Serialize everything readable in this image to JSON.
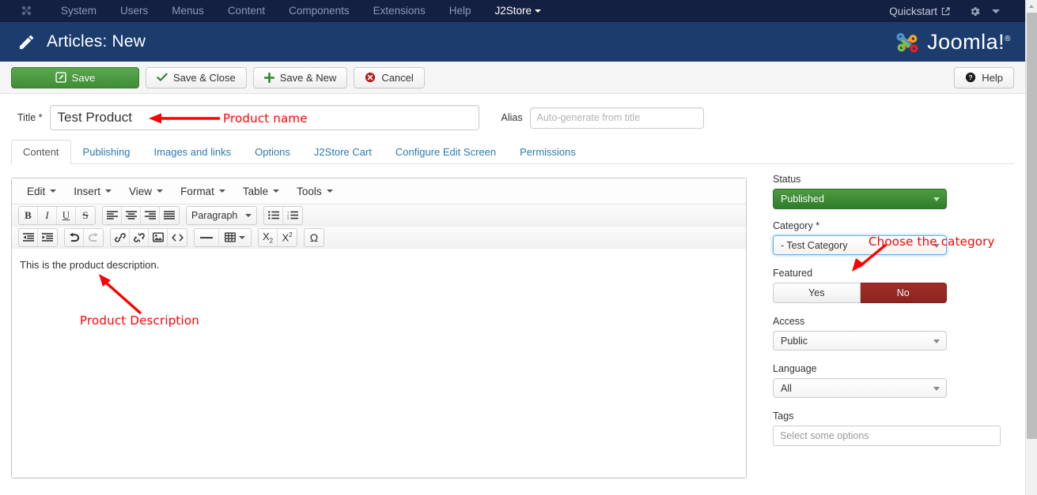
{
  "topbar": {
    "brand_icon": "joomla-logo-icon",
    "menu": [
      {
        "label": "System",
        "id": "system"
      },
      {
        "label": "Users",
        "id": "users"
      },
      {
        "label": "Menus",
        "id": "menus"
      },
      {
        "label": "Content",
        "id": "content"
      },
      {
        "label": "Components",
        "id": "components"
      },
      {
        "label": "Extensions",
        "id": "extensions"
      },
      {
        "label": "Help",
        "id": "help"
      }
    ],
    "j2store_label": "J2Store",
    "quickstart_label": "Quickstart",
    "quickstart_icon": "external-link-icon",
    "gear_icon": "gear-icon",
    "caret_icon": "chevron-down-icon",
    "bg_color": "#142042"
  },
  "subhead": {
    "icon": "pencil-icon",
    "title": "Articles: New",
    "logo_text": "Joomla!",
    "logo_sup": "®",
    "bg_color": "#1c3c6e"
  },
  "toolbar": {
    "save_label": "Save",
    "save_icon": "edit-square-icon",
    "save_close_label": "Save & Close",
    "save_close_icon": "check-icon",
    "save_new_label": "Save & New",
    "save_new_icon": "plus-icon",
    "cancel_label": "Cancel",
    "cancel_icon": "cancel-circle-icon",
    "help_label": "Help",
    "help_icon": "question-circle-icon",
    "save_color": "#3f8e35"
  },
  "title_row": {
    "title_label": "Title *",
    "title_value": "Test Product",
    "alias_label": "Alias",
    "alias_value": "",
    "alias_placeholder": "Auto-generate from title"
  },
  "tabs": [
    {
      "label": "Content",
      "active": true
    },
    {
      "label": "Publishing",
      "active": false
    },
    {
      "label": "Images and links",
      "active": false
    },
    {
      "label": "Options",
      "active": false
    },
    {
      "label": "J2Store Cart",
      "active": false
    },
    {
      "label": "Configure Edit Screen",
      "active": false
    },
    {
      "label": "Permissions",
      "active": false
    }
  ],
  "editor": {
    "menus": [
      {
        "label": "Edit"
      },
      {
        "label": "Insert"
      },
      {
        "label": "View"
      },
      {
        "label": "Format"
      },
      {
        "label": "Table"
      },
      {
        "label": "Tools"
      }
    ],
    "toolbar_row1": [
      {
        "icon": "bold-icon",
        "glyph": "B"
      },
      {
        "icon": "italic-icon",
        "glyph": "I"
      },
      {
        "icon": "underline-icon",
        "glyph": "U"
      },
      {
        "icon": "strikethrough-icon",
        "glyph": "S"
      }
    ],
    "align_buttons": [
      {
        "icon": "align-left-icon"
      },
      {
        "icon": "align-center-icon"
      },
      {
        "icon": "align-right-icon"
      },
      {
        "icon": "align-justify-icon"
      }
    ],
    "format_select": "Paragraph",
    "list_buttons": [
      {
        "icon": "bullet-list-icon"
      },
      {
        "icon": "numbered-list-icon"
      }
    ],
    "toolbar_row2_indent": [
      {
        "icon": "outdent-icon"
      },
      {
        "icon": "indent-icon"
      }
    ],
    "toolbar_row2_history": [
      {
        "icon": "undo-icon"
      },
      {
        "icon": "redo-icon"
      }
    ],
    "toolbar_row2_insert": [
      {
        "icon": "link-icon"
      },
      {
        "icon": "unlink-icon"
      },
      {
        "icon": "image-icon"
      },
      {
        "icon": "source-code-icon"
      }
    ],
    "toolbar_row2_block": [
      {
        "icon": "horizontal-rule-icon"
      },
      {
        "icon": "table-icon"
      }
    ],
    "toolbar_row2_script": [
      {
        "icon": "subscript-icon"
      },
      {
        "icon": "superscript-icon"
      }
    ],
    "toolbar_row2_special": [
      {
        "icon": "special-character-icon",
        "glyph": "Ω"
      }
    ],
    "body_text": "This is the product description."
  },
  "sidebar": {
    "status_label": "Status",
    "status_value": "Published",
    "category_label": "Category *",
    "category_value": "- Test Category",
    "featured_label": "Featured",
    "featured_yes": "Yes",
    "featured_no": "No",
    "featured_selected": "No",
    "access_label": "Access",
    "access_value": "Public",
    "language_label": "Language",
    "language_value": "All",
    "tags_label": "Tags",
    "tags_placeholder": "Select some options",
    "published_color": "#3f8e35",
    "no_color": "#8c2420"
  },
  "annotations": [
    {
      "id": "product-name",
      "text": "Product name",
      "color": "#ff0000"
    },
    {
      "id": "product-description",
      "text": "Product Description",
      "color": "#ff0000"
    },
    {
      "id": "choose-category",
      "text": "Choose the category",
      "color": "#ff0000"
    }
  ]
}
